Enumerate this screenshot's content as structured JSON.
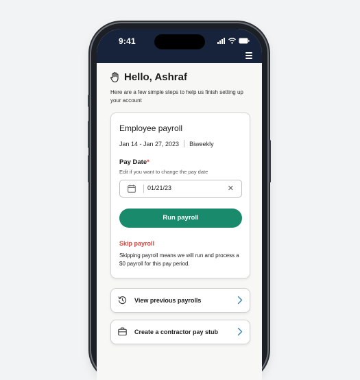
{
  "status_bar": {
    "time": "9:41"
  },
  "greeting": {
    "title": "Hello, Ashraf",
    "subtitle": "Here are a few simple steps to help us finish setting up your account"
  },
  "payroll_card": {
    "title": "Employee payroll",
    "date_range": "Jan 14 - Jan 27, 2023",
    "frequency": "Biweekly",
    "pay_date_label": "Pay Date",
    "required_marker": "*",
    "pay_date_hint": "Edit if you want to change the pay date",
    "pay_date_value": "01/21/23",
    "run_button": "Run payroll",
    "skip_link": "Skip payroll",
    "skip_description": "Skipping payroll means we will run and process a $0 payroll for this pay period."
  },
  "links": [
    {
      "label": "View previous payrolls",
      "icon": "history-icon"
    },
    {
      "label": "Create a contractor pay stub",
      "icon": "briefcase-icon"
    }
  ],
  "colors": {
    "header_bg": "#17233a",
    "primary": "#1a8a6c",
    "danger": "#d8433a",
    "accent_chevron": "#2f7fb8"
  }
}
